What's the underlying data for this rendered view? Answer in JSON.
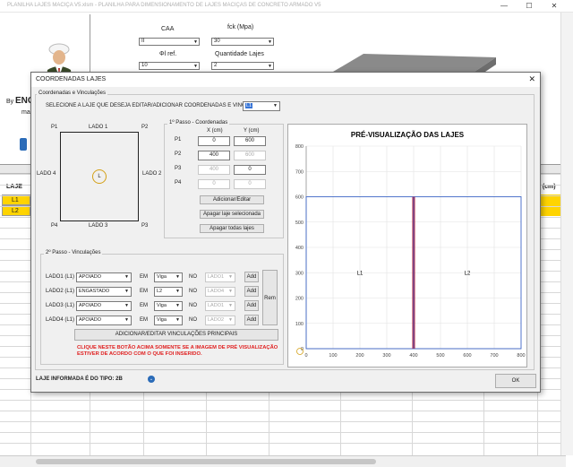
{
  "window": {
    "title": "PLANILHA  LAJES MACIÇA V5.xlsm - PLANILHA PARA DIMENSIONAMENTO DE LAJES MACIÇAS DE CONCRETO ARMADO V5",
    "minimize": "—",
    "restore": "☐",
    "close": "✕"
  },
  "excel": {
    "caa_label": "CAA",
    "caa_value": "II",
    "fck_label": "fck (Mpa)",
    "fck_value": "30",
    "phi_label": "Φl ref.",
    "phi_value": "10",
    "qty_label": "Quantidade Lajes",
    "qty_value": "2",
    "by_prefix": "By",
    "brand_text": "ENG",
    "brand_sub": "ma",
    "col_laje_header": "LAJE",
    "col_right_header": "s (cm)",
    "rows": [
      "L1",
      "L2"
    ]
  },
  "dialog": {
    "title": "COORDENADAS LAJES",
    "close_icon": "✕",
    "group_coords_label": "Coordenadas e Vinculações",
    "select_prompt": "SELECIONE A LAJE QUE DESEJA EDITAR/ADICIONAR COORDENADAS E VINCULAÇÕES",
    "select_value": "L1",
    "diagram": {
      "p1": "P1",
      "p2": "P2",
      "p3": "P3",
      "p4": "P4",
      "lado1": "LADO 1",
      "lado2": "LADO 2",
      "lado3": "LADO 3",
      "lado4": "LADO 4",
      "center": "L"
    },
    "step1": {
      "label": "1º Passo - Coordenadas",
      "x_header": "X (cm)",
      "y_header": "Y (cm)",
      "points": [
        {
          "name": "P1",
          "x": "0",
          "y": "600",
          "xdis": false,
          "ydis": false
        },
        {
          "name": "P2",
          "x": "400",
          "y": "600",
          "xdis": false,
          "ydis": true
        },
        {
          "name": "P3",
          "x": "400",
          "y": "0",
          "xdis": true,
          "ydis": false
        },
        {
          "name": "P4",
          "x": "0",
          "y": "0",
          "xdis": true,
          "ydis": true
        }
      ],
      "add_btn": "Adicionar/Editar",
      "delete_selected_btn": "Apagar laje selecionada",
      "delete_all_btn": "Apagar todas lajes"
    },
    "step2": {
      "label": "2º Passo - Vinculações",
      "rows": [
        {
          "lado": "LADO1 (L1)",
          "tipo": "APOIADO",
          "em": "EM",
          "elem": "Viga",
          "no": "NO",
          "ref": "LADO1",
          "add": "Add"
        },
        {
          "lado": "LADO2 (L1)",
          "tipo": "ENGASTADO",
          "em": "EM",
          "elem": "L2",
          "no": "NO",
          "ref": "LADO4",
          "add": "Add"
        },
        {
          "lado": "LADO3 (L1)",
          "tipo": "APOIADO",
          "em": "EM",
          "elem": "Viga",
          "no": "NO",
          "ref": "LADO1",
          "add": "Add"
        },
        {
          "lado": "LADO4 (L1)",
          "tipo": "APOIADO",
          "em": "EM",
          "elem": "Viga",
          "no": "NO",
          "ref": "LADO2",
          "add": "Add"
        }
      ],
      "rem_btn": "Rem",
      "main_btn": "ADICIONAR/EDITAR VINCULAÇÕES PRINCIPAIS",
      "warning_line1": "CLIQUE NESTE BOTÃO ACIMA SOMENTE SE A IMAGEM DE PRÉ VISUALIZAÇÃO",
      "warning_line2": "ESTIVER DE ACORDO COM O QUE FOI INSERIDO."
    },
    "footer_text": "LAJE INFORMADA É DO TIPO: 2B",
    "ok_btn": "OK"
  },
  "chart_data": {
    "type": "line",
    "title": "PRÉ-VISUALIZAÇÃO DAS LAJES",
    "xlim": [
      0,
      800
    ],
    "ylim": [
      0,
      800
    ],
    "xticks": [
      0,
      100,
      200,
      300,
      400,
      500,
      600,
      700,
      800
    ],
    "yticks": [
      0,
      100,
      200,
      300,
      400,
      500,
      600,
      700,
      800
    ],
    "grid": true,
    "slabs": [
      {
        "name": "L1",
        "x": [
          0,
          400
        ],
        "y": [
          0,
          600
        ],
        "color": "#4169c8"
      },
      {
        "name": "L2",
        "x": [
          400,
          800
        ],
        "y": [
          0,
          600
        ],
        "color": "#4169c8"
      }
    ],
    "shared_edge": {
      "x": 400,
      "y": [
        0,
        600
      ],
      "color": "#c0203a"
    }
  },
  "colors": {
    "accent_yellow": "#ffd400",
    "slab_outline": "#4169c8",
    "shared_edge": "#c0203a",
    "warning_red": "#e02020"
  }
}
